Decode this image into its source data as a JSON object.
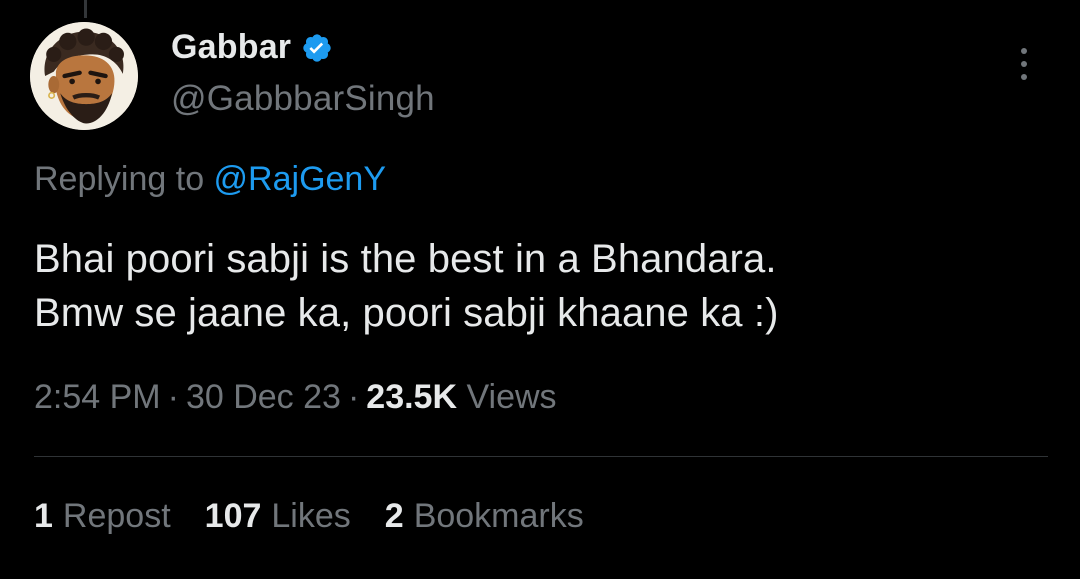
{
  "author": {
    "display_name": "Gabbar",
    "handle": "@GabbbarSingh",
    "verified": true
  },
  "reply": {
    "prefix": "Replying to ",
    "mention": "@RajGenY"
  },
  "tweet": {
    "lines": [
      "Bhai poori sabji is the best in a Bhandara.",
      "Bmw se jaane ka, poori sabji khaane ka :)"
    ]
  },
  "meta": {
    "time": "2:54 PM",
    "separator": "·",
    "date": "30 Dec 23",
    "views_count": "23.5K",
    "views_label": "Views"
  },
  "stats": [
    {
      "count": "1",
      "label": "Repost"
    },
    {
      "count": "107",
      "label": "Likes"
    },
    {
      "count": "2",
      "label": "Bookmarks"
    }
  ],
  "colors": {
    "background": "#000000",
    "text_primary": "#e7e9ea",
    "text_secondary": "#71767b",
    "accent": "#1d9bf0",
    "divider": "#2f3336"
  },
  "icons": [
    "verified-badge-icon",
    "more-options-icon"
  ]
}
